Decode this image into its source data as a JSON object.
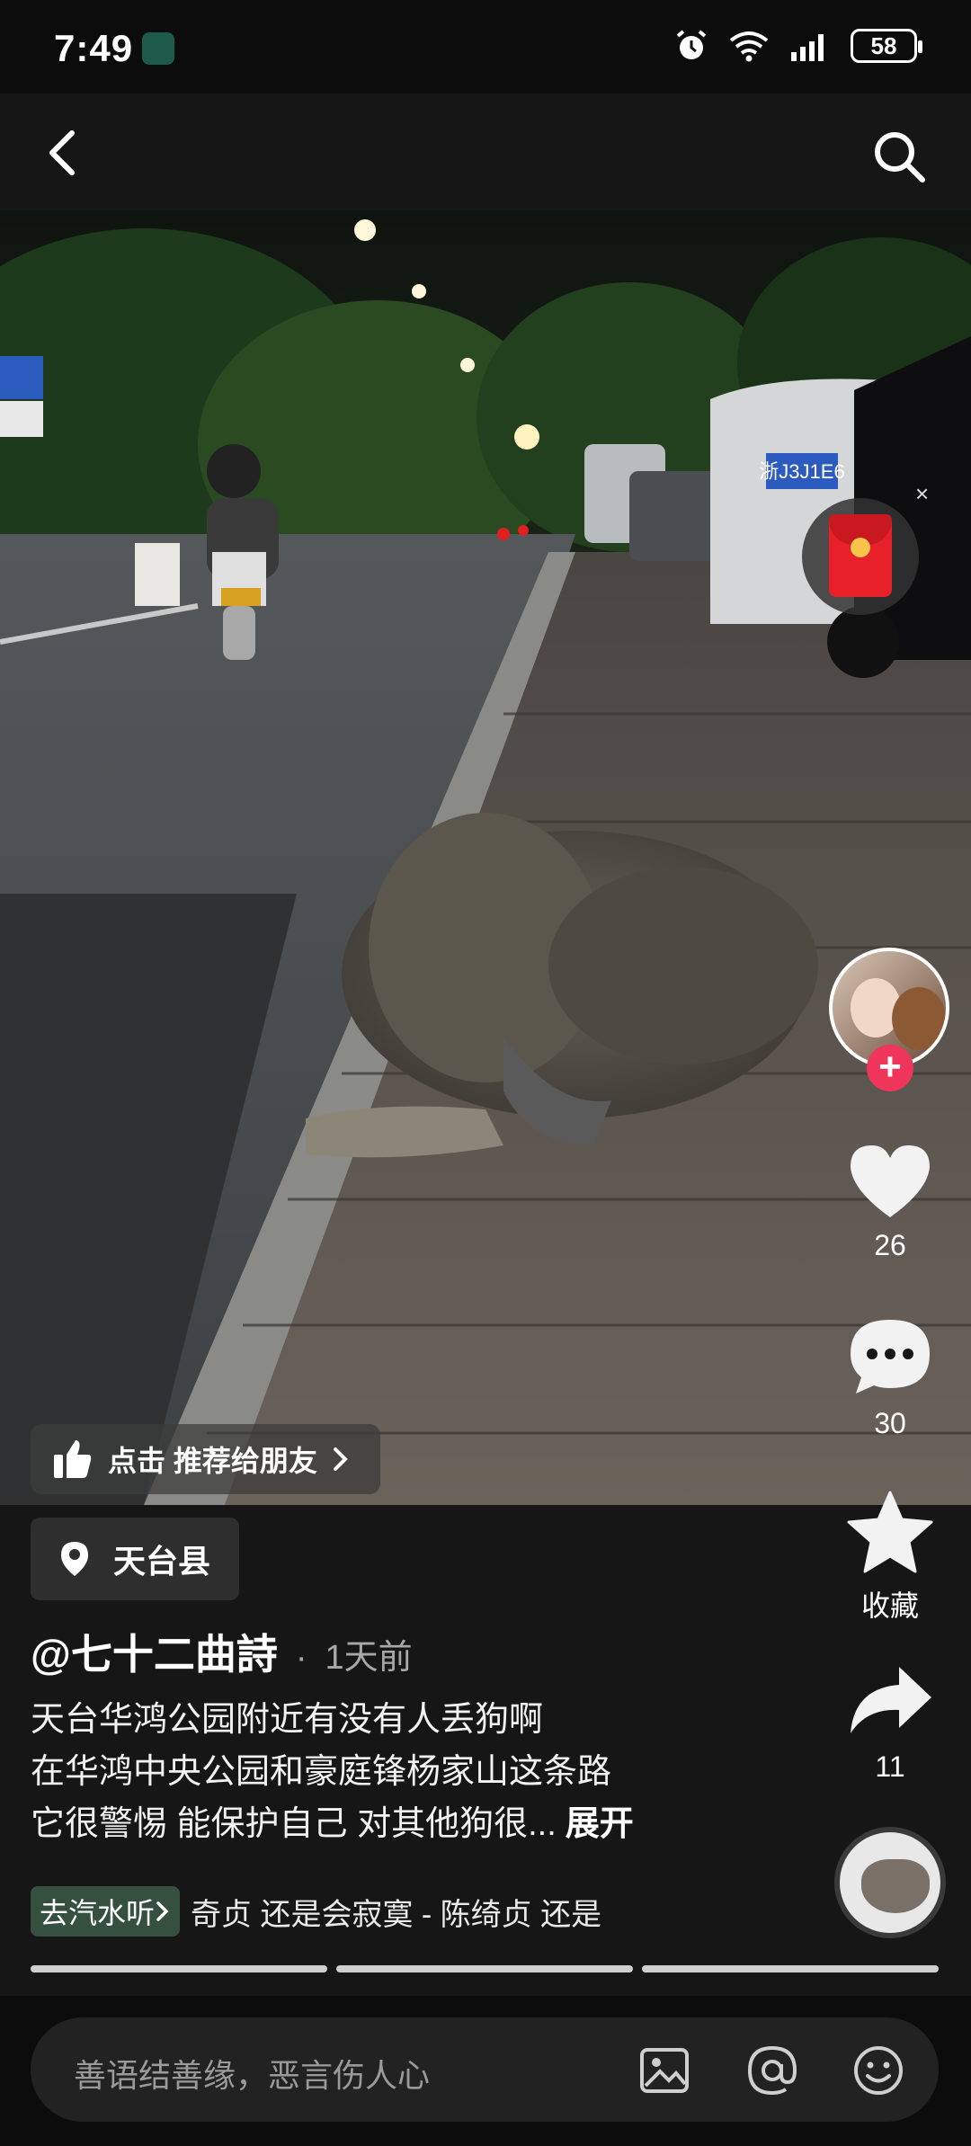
{
  "status_bar": {
    "time": "7:49",
    "battery": "58",
    "icons": [
      "alarm-icon",
      "wifi-icon",
      "signal-icon",
      "battery-icon"
    ]
  },
  "nav": {
    "back_icon": "chevron-left-icon",
    "search_icon": "search-icon"
  },
  "video": {
    "description": "night street scene",
    "plate_text": "浙J3J1E6",
    "recommend_label": "点击 推荐给朋友",
    "redpacket_close": "×"
  },
  "rail": {
    "like_count": "26",
    "comment_count": "30",
    "favorite_label": "收藏",
    "share_count": "11",
    "follow_plus": "+"
  },
  "info": {
    "location": "天台县",
    "author": "@七十二曲詩",
    "time_sep": "·",
    "post_time": "1天前",
    "desc_lines": [
      "天台华鸿公园附近有没有人丢狗啊",
      "在华鸿中央公园和豪庭锋杨家山这条路",
      "它很警惕 能保护自己 对其他狗很..."
    ],
    "expand_label": "展开",
    "music_tag": "去汽水听",
    "music_text": "奇贞    还是会寂寞 - 陈绮贞    还是"
  },
  "comment_bar": {
    "placeholder": "善语结善缘，恶言伤人心",
    "icons": [
      "image-icon",
      "at-icon",
      "emoji-icon"
    ]
  },
  "colors": {
    "background": "#0c0c0c",
    "panel": "#161616",
    "follow_red": "#f0355a",
    "music_tag_green": "#35503e",
    "redpacket_red": "#e8202a"
  }
}
